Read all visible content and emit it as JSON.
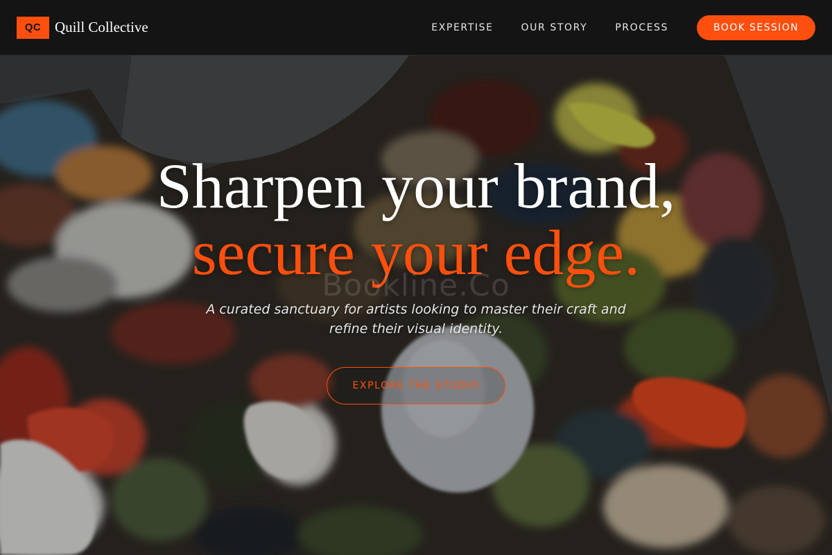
{
  "brand": {
    "logo_text": "QC",
    "name": "Quill Collective"
  },
  "nav": {
    "links": [
      "EXPERTISE",
      "OUR STORY",
      "PROCESS"
    ],
    "cta_label": "BOOK SESSION"
  },
  "hero": {
    "headline_line1": "Sharpen your brand,",
    "headline_line2": "secure your edge.",
    "watermark": "Bookline.Co",
    "subtitle": "A curated sanctuary for artists looking to master their craft and refine their visual identity.",
    "cta_label": "EXPLORE THE STUDIO"
  },
  "colors": {
    "accent": "#ff4f0f",
    "header_bg": "#141414",
    "text": "#ffffff"
  },
  "icons": {
    "hero_background": "paint-palette-image"
  }
}
